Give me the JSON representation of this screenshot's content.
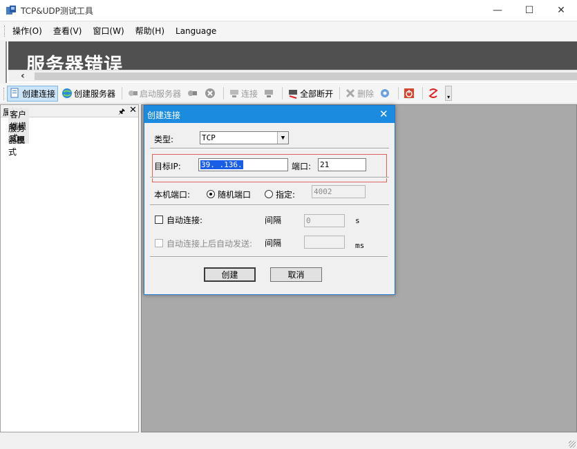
{
  "window": {
    "title": "TCP&UDP测试工具",
    "min": "—",
    "max": "☐",
    "close": "✕"
  },
  "menu": [
    "操作(O)",
    "查看(V)",
    "窗口(W)",
    "帮助(H)",
    "Language"
  ],
  "banner": {
    "text": "服务器错误",
    "scroll_left": "‹"
  },
  "toolbar": {
    "create_connection": "创建连接",
    "create_server": "创建服务器",
    "start_server": "启动服务器",
    "connect": "连接",
    "disconnect_all": "全部断开",
    "delete": "删除",
    "more": "▾"
  },
  "left_panel": {
    "title": "属性栏",
    "pin": "ᵖ",
    "close": "✕",
    "items": [
      "客户端模式",
      "服务器模式"
    ]
  },
  "dialog": {
    "title": "创建连接",
    "close": "✕",
    "type_label": "类型:",
    "type_value": "TCP",
    "target_ip_label": "目标IP:",
    "target_ip_value": "39.   .136.  ",
    "port_label": "端口:",
    "port_value": "21",
    "local_port_label": "本机端口:",
    "random_port_label": "随机端口",
    "specify_label": "指定:",
    "specify_value": "4002",
    "auto_connect_label": "自动连接:",
    "interval_label_1": "间隔",
    "interval_value_1": "0",
    "unit_1": "s",
    "auto_send_label": "自动连接上后自动发送:",
    "interval_label_2": "间隔",
    "interval_value_2": "",
    "unit_2": "ms",
    "create_button": "创建",
    "cancel_button": "取消"
  },
  "colors": {
    "banner_bg": "#505050",
    "work_area": "#a9a9a9",
    "dialog_title": "#1b8be0",
    "highlight_box": "#e06060"
  }
}
